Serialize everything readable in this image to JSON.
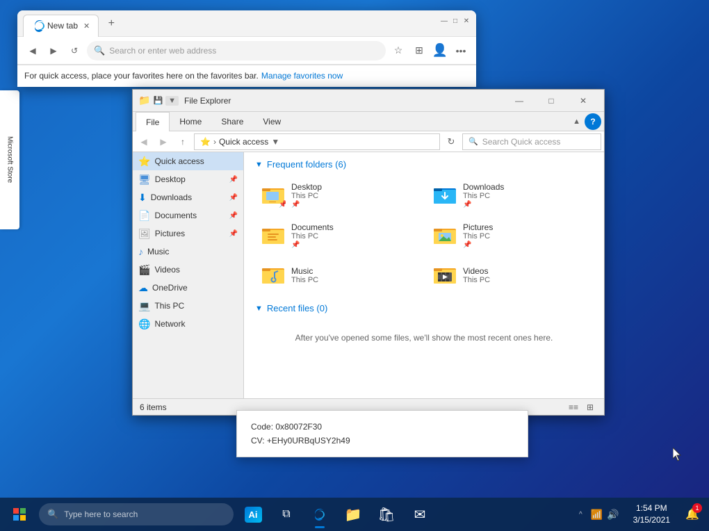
{
  "desktop": {
    "background": "#1565c0"
  },
  "browser": {
    "tab_title": "New tab",
    "address_placeholder": "Search or enter web address",
    "favorites_text": "For quick access, place your favorites here on the favorites bar.",
    "manage_link": "Manage favorites now",
    "window_controls": [
      "—",
      "□",
      "✕"
    ]
  },
  "file_explorer": {
    "title": "File Explorer",
    "ribbon_tabs": [
      "File",
      "Home",
      "Share",
      "View"
    ],
    "active_tab": "File",
    "path": "Quick access",
    "search_placeholder": "Search Quick access",
    "nav_buttons": {
      "back": "◀",
      "forward": "▶",
      "up": "▲",
      "refresh": "↻"
    },
    "section_frequent": "Frequent folders (6)",
    "section_recent": "Recent files (0)",
    "recent_empty_text": "After you've opened some files, we'll show the most recent ones here.",
    "status_items": "6 items",
    "folders": [
      {
        "name": "Desktop",
        "subtitle": "This PC",
        "pinned": true,
        "icon": "desktop"
      },
      {
        "name": "Downloads",
        "subtitle": "This PC",
        "pinned": true,
        "icon": "download"
      },
      {
        "name": "Documents",
        "subtitle": "This PC",
        "pinned": true,
        "icon": "document"
      },
      {
        "name": "Pictures",
        "subtitle": "This PC",
        "pinned": true,
        "icon": "pictures"
      },
      {
        "name": "Music",
        "subtitle": "This PC",
        "pinned": false,
        "icon": "music"
      },
      {
        "name": "Videos",
        "subtitle": "This PC",
        "pinned": false,
        "icon": "videos"
      }
    ],
    "sidebar_items": [
      {
        "label": "Quick access",
        "icon": "⭐",
        "active": true
      },
      {
        "label": "Desktop",
        "icon": "🖥",
        "pinned": true
      },
      {
        "label": "Downloads",
        "icon": "⬇",
        "pinned": true
      },
      {
        "label": "Documents",
        "icon": "📄",
        "pinned": true
      },
      {
        "label": "Pictures",
        "icon": "🖼",
        "pinned": true
      },
      {
        "label": "Music",
        "icon": "♪",
        "pinned": false
      },
      {
        "label": "Videos",
        "icon": "🎬",
        "pinned": false
      },
      {
        "label": "OneDrive",
        "icon": "☁",
        "pinned": false
      },
      {
        "label": "This PC",
        "icon": "💻",
        "pinned": false
      },
      {
        "label": "Network",
        "icon": "🌐",
        "pinned": false
      }
    ]
  },
  "error_dialog": {
    "line1": "Code: 0x80072F30",
    "line2": "CV: +EHy0URBqUSY2h49"
  },
  "taskbar": {
    "search_placeholder": "Type here to search",
    "ai_label": "Ai",
    "time": "1:54 PM",
    "date": "3/15/2021",
    "notification_count": "1",
    "icons": [
      "⊞",
      "🔍",
      "🤖",
      "⬆",
      "📁",
      "🛍",
      "✉"
    ]
  }
}
